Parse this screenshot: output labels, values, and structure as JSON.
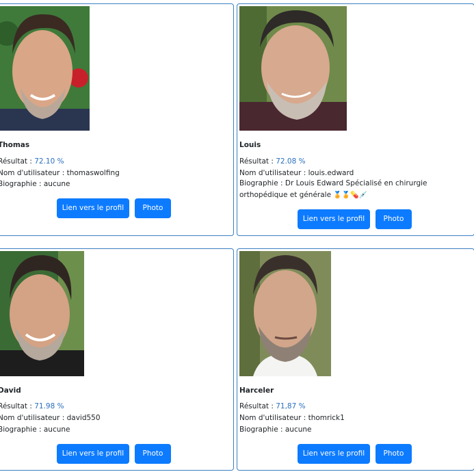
{
  "labels": {
    "result_prefix": "Résultat : ",
    "username_prefix": "Nom d'utilisateur : ",
    "bio_prefix": "Biographie : ",
    "profile_button": "Lien vers le profil",
    "photo_button": "Photo"
  },
  "cards": [
    {
      "name": "Thomas",
      "score": "72.10 %",
      "username": "thomaswolfing",
      "bio": "aucune"
    },
    {
      "name": "Louis",
      "score": "72.08 %",
      "username": "louis.edward",
      "bio": "Dr Louis Edward Spécialisé en chirurgie orthopédique et générale",
      "bio_emoji": "🏅🏅💊💉"
    },
    {
      "name": "David",
      "score": "71.98 %",
      "username": "david550",
      "bio": "aucune"
    },
    {
      "name": "Harceler",
      "score": "71,87 %",
      "username": "thomrick1",
      "bio": "aucune"
    }
  ]
}
